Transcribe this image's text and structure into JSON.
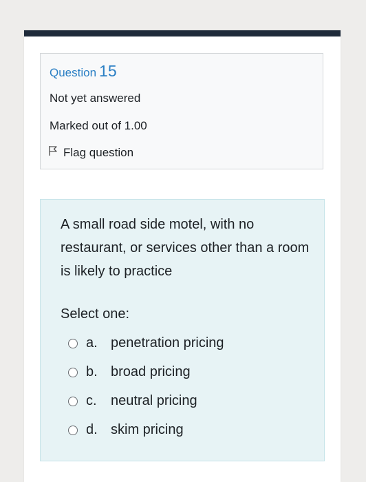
{
  "question": {
    "label": "Question",
    "number": "15",
    "state": "Not yet answered",
    "grade": "Marked out of 1.00",
    "flag_label": "Flag question"
  },
  "content": {
    "text": "A small road side motel, with no restaurant, or services other than a room is likely to practice",
    "prompt": "Select one:",
    "options": [
      {
        "letter": "a.",
        "text": "penetration pricing"
      },
      {
        "letter": "b.",
        "text": "broad pricing"
      },
      {
        "letter": "c.",
        "text": "neutral pricing"
      },
      {
        "letter": "d.",
        "text": "skim pricing"
      }
    ]
  },
  "colors": {
    "accent": "#2a7fc4",
    "header_bar": "#1e2a3a",
    "content_bg": "#e7f3f5",
    "info_bg": "#f8f9fa"
  }
}
